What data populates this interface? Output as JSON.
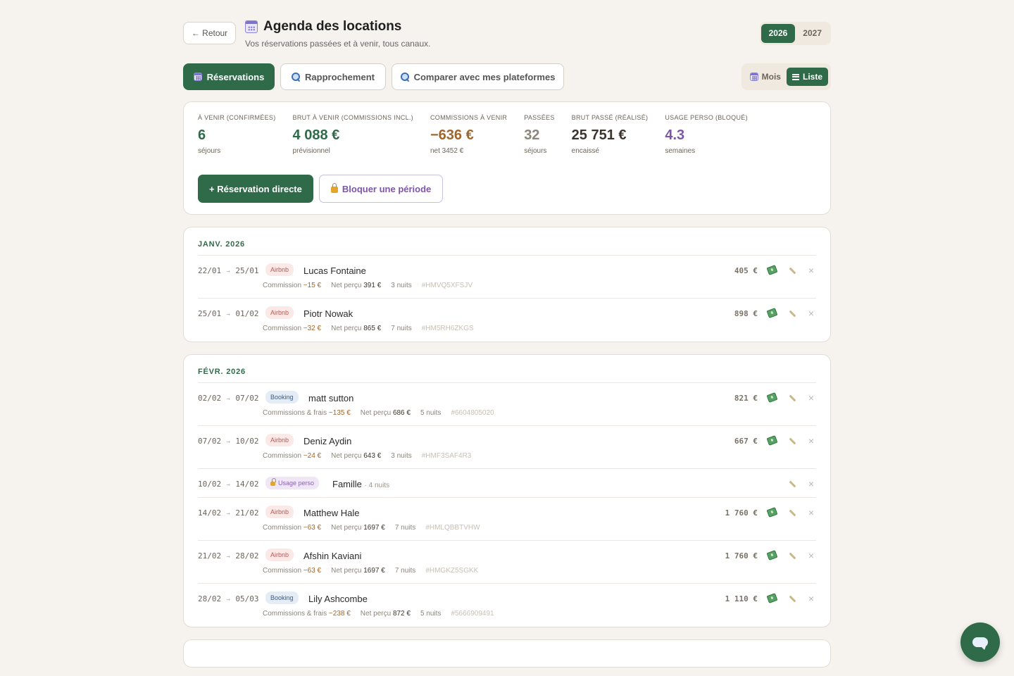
{
  "header": {
    "back_label": "← Retour",
    "title": "Agenda des locations",
    "subtitle": "Vos réservations passées et à venir, tous canaux.",
    "years": [
      "2026",
      "2027"
    ],
    "active_year": "2026"
  },
  "tabs": [
    {
      "label": "Réservations",
      "icon": "calendar-icon",
      "active": true
    },
    {
      "label": "Rapprochement",
      "icon": "search-icon",
      "active": false
    },
    {
      "label": "Comparer avec mes plateformes",
      "icon": "search-icon",
      "active": false
    }
  ],
  "view_switch": {
    "month_label": "Mois",
    "list_label": "Liste",
    "active": "Liste"
  },
  "stats": [
    {
      "label": "À venir (confirmées)",
      "value": "6",
      "sub": "séjours",
      "color": "#2f6b49"
    },
    {
      "label": "Brut à venir (commissions incl.)",
      "value": "4 088 €",
      "sub": "prévisionnel",
      "color": "#2f6b49"
    },
    {
      "label": "Commissions à venir",
      "value": "−636 €",
      "sub": "net 3452 €",
      "color": "#a0652a"
    },
    {
      "label": "Passées",
      "value": "32",
      "sub": "séjours",
      "color": "#8b857a"
    },
    {
      "label": "Brut passé (réalisé)",
      "value": "25 751 €",
      "sub": "encaissé",
      "color": "#3a342c"
    },
    {
      "label": "Usage perso (bloqué)",
      "value": "4.3",
      "sub": "semaines",
      "color": "#7d56a8"
    }
  ],
  "actions": {
    "direct_label": "+ Réservation directe",
    "block_label": "Bloquer une période"
  },
  "months": [
    {
      "title": "JANV. 2026",
      "rows": [
        {
          "start": "22/01",
          "end": "25/01",
          "platform": "Airbnb",
          "guest": "Lucas Fontaine",
          "commission_label": "Commission",
          "commission": "−15 €",
          "net_label": "Net perçu",
          "net": "391 €",
          "nights": "3 nuits",
          "ref": "#HMVQ5XFSJV",
          "amount": "405 €"
        },
        {
          "start": "25/01",
          "end": "01/02",
          "platform": "Airbnb",
          "guest": "Piotr Nowak",
          "commission_label": "Commission",
          "commission": "−32 €",
          "net_label": "Net perçu",
          "net": "865 €",
          "nights": "7 nuits",
          "ref": "#HM5RH6ZKGS",
          "amount": "898 €"
        }
      ]
    },
    {
      "title": "FÉVR. 2026",
      "rows": [
        {
          "start": "02/02",
          "end": "07/02",
          "platform": "Booking",
          "guest": "matt sutton",
          "commission_label": "Commissions & frais",
          "commission": "−135 €",
          "net_label": "Net perçu",
          "net": "686 €",
          "nights": "5 nuits",
          "ref": "#6604805020",
          "amount": "821 €"
        },
        {
          "start": "07/02",
          "end": "10/02",
          "platform": "Airbnb",
          "guest": "Deniz Aydin",
          "commission_label": "Commission",
          "commission": "−24 €",
          "net_label": "Net perçu",
          "net": "643 €",
          "nights": "3 nuits",
          "ref": "#HMF3SAF4R3",
          "amount": "667 €"
        },
        {
          "start": "10/02",
          "end": "14/02",
          "platform": "Usage perso",
          "guest": "Famille",
          "nights_inline": "· 4 nuits",
          "personal": true
        },
        {
          "start": "14/02",
          "end": "21/02",
          "platform": "Airbnb",
          "guest": "Matthew Hale",
          "commission_label": "Commission",
          "commission": "−63 €",
          "net_label": "Net perçu",
          "net": "1697 €",
          "nights": "7 nuits",
          "ref": "#HMLQBBTVHW",
          "amount": "1 760 €"
        },
        {
          "start": "21/02",
          "end": "28/02",
          "platform": "Airbnb",
          "guest": "Afshin Kaviani",
          "commission_label": "Commission",
          "commission": "−63 €",
          "net_label": "Net perçu",
          "net": "1697 €",
          "nights": "7 nuits",
          "ref": "#HMGKZ5SGKK",
          "amount": "1 760 €"
        },
        {
          "start": "28/02",
          "end": "05/03",
          "platform": "Booking",
          "guest": "Lily Ashcombe",
          "commission_label": "Commissions & frais",
          "commission": "−238 €",
          "net_label": "Net perçu",
          "net": "872 €",
          "nights": "5 nuits",
          "ref": "#5666909491",
          "amount": "1 110 €"
        }
      ]
    }
  ],
  "colors": {
    "accent": "#2f6b49",
    "background": "#f6f3ee",
    "airbnb": "#b25a55",
    "booking": "#3f5b82",
    "personal": "#8a64b0"
  }
}
